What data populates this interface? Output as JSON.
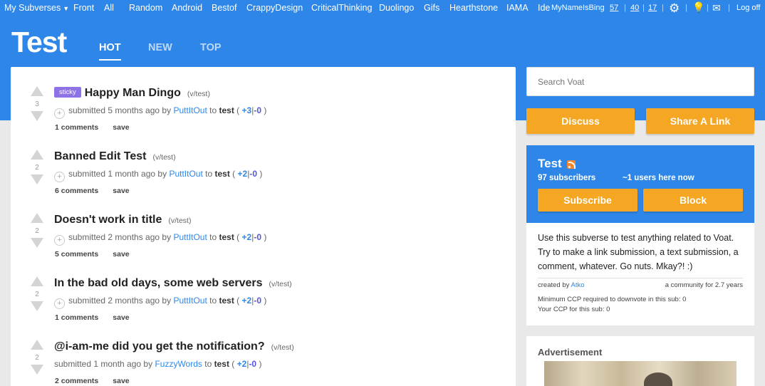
{
  "topbar": {
    "my_subverses": "My Subverses",
    "links": [
      "Front",
      "All",
      "Random",
      "Android",
      "Bestof",
      "CrappyDesign",
      "CriticalThinking",
      "Duolingo",
      "Gifs",
      "Hearthstone",
      "IAMA",
      "Ide"
    ],
    "username": "MyNameIsBing",
    "points": [
      "57",
      "40",
      "17"
    ],
    "logout": "Log off"
  },
  "header": {
    "title": "Test",
    "tabs": [
      "HOT",
      "NEW",
      "TOP"
    ],
    "active_tab": "HOT"
  },
  "posts": [
    {
      "score": "3",
      "sticky": "sticky",
      "title": "Happy Man Dingo",
      "domain": "(v/test)",
      "submitted": "submitted 5 months ago by",
      "author": "PuttItOut",
      "to": "to",
      "sub": "test",
      "up": "+3",
      "down": "-0",
      "comments": "1 comments",
      "save": "save"
    },
    {
      "score": "2",
      "title": "Banned Edit Test",
      "domain": "(v/test)",
      "submitted": "submitted 1 month ago by",
      "author": "PuttItOut",
      "to": "to",
      "sub": "test",
      "up": "+2",
      "down": "-0",
      "comments": "6 comments",
      "save": "save"
    },
    {
      "score": "2",
      "title": "Doesn't work in title",
      "domain": "(v/test)",
      "submitted": "submitted 2 months ago by",
      "author": "PuttItOut",
      "to": "to",
      "sub": "test",
      "up": "+2",
      "down": "-0",
      "comments": "5 comments",
      "save": "save"
    },
    {
      "score": "2",
      "title": "In the bad old days, some web servers",
      "domain": "(v/test)",
      "submitted": "submitted 2 months ago by",
      "author": "PuttItOut",
      "to": "to",
      "sub": "test",
      "up": "+2",
      "down": "-0",
      "comments": "1 comments",
      "save": "save"
    },
    {
      "score": "2",
      "title": "@i-am-me did you get the notification?",
      "domain": "(v/test)",
      "submitted": "submitted 1 month ago by",
      "author": "FuzzyWords",
      "to": "to",
      "sub": "test",
      "up": "+2",
      "down": "-0",
      "comments": "2 comments",
      "save": "save"
    }
  ],
  "sidebar": {
    "search_placeholder": "Search Voat",
    "discuss_label": "Discuss",
    "share_label": "Share A Link",
    "sub_name": "Test",
    "subscribers": "97 subscribers",
    "users_here": "~1 users here now",
    "subscribe_label": "Subscribe",
    "block_label": "Block",
    "description": "Use this subverse to test anything related to Voat. Try to make a link submission, a text submission, a comment, whatever. Go nuts. Mkay?! :)",
    "created_by": "created by",
    "creator": "Atko",
    "community_age": "a community for 2.7 years",
    "min_ccp": "Minimum CCP required to downvote in this sub: 0",
    "your_ccp": "Your CCP for this sub: 0",
    "ad_title": "Advertisement"
  },
  "colors": {
    "brand_blue": "#2e87e8",
    "button_orange": "#f5a623",
    "sticky_purple": "#8e73e6"
  }
}
